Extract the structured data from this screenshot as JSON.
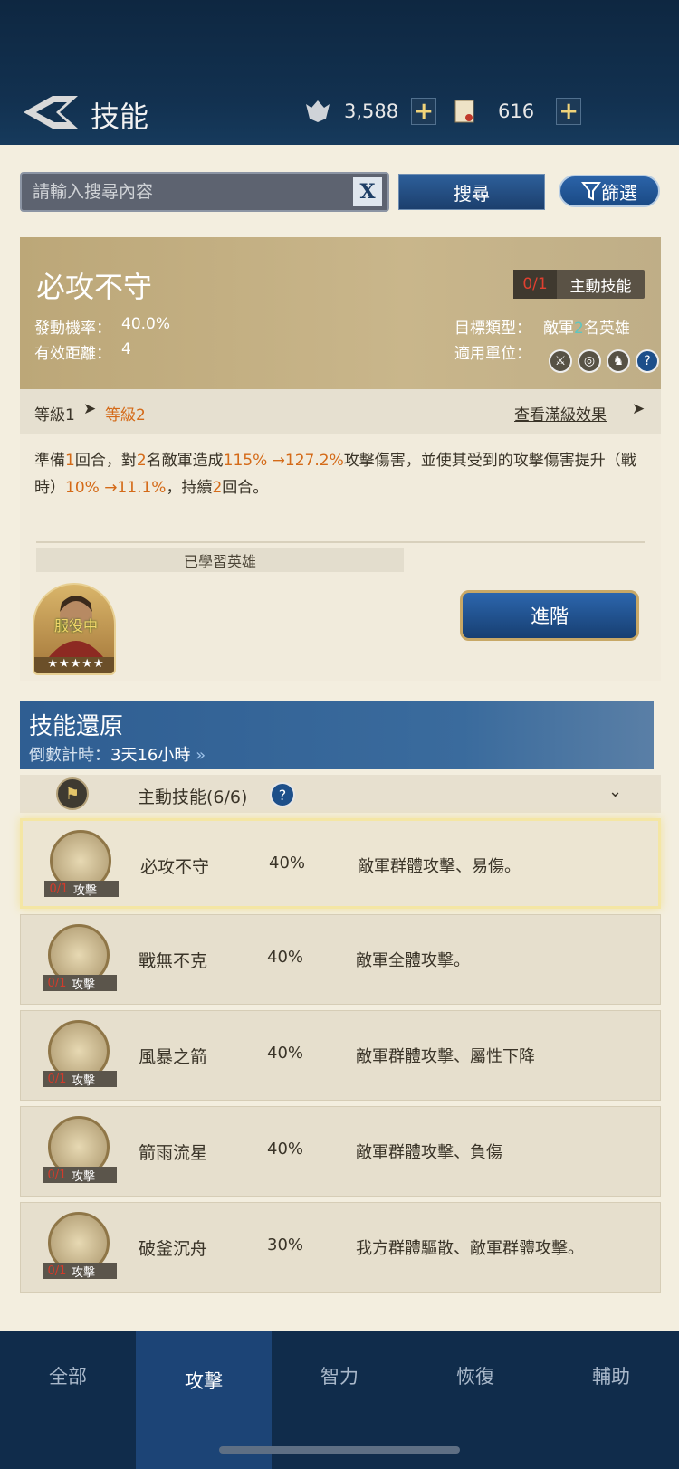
{
  "header": {
    "title": "技能",
    "res1_value": "3,588",
    "res2_value": "616",
    "plus": "+"
  },
  "search": {
    "placeholder": "請輸入搜尋內容",
    "clear_label": "X",
    "search_label": "搜尋",
    "filter_label": "篩選"
  },
  "skill": {
    "name": "必攻不守",
    "uses": "0/1",
    "type_label": "主動技能",
    "rate_label": "發動機率：",
    "rate_value": "40.0%",
    "range_label": "有效距離：",
    "range_value": "4",
    "target_label": "目標類型：",
    "target_value_a": "敵軍",
    "target_value_b": "2",
    "target_value_c": "名英雄",
    "units_label": "適用單位：",
    "level_from": "等級1",
    "level_to": "等級2",
    "max_effect_label": "查看滿級效果",
    "desc": {
      "a": "準備",
      "b": "1",
      "c": "回合，對",
      "d": "2",
      "e": "名敵軍造成",
      "f": "115% →127.2%",
      "g": "攻擊傷害，並使其受到的攻擊傷害提升（戰時）",
      "h": "10% →11.1%",
      "i": "，持續",
      "j": "2",
      "k": "回合。"
    },
    "learned_label": "已學習英雄",
    "hero_status": "服役中",
    "hero_stars": "★★★★★",
    "upgrade_label": "進階"
  },
  "reset": {
    "title": "技能還原",
    "countdown_label": "倒數計時：",
    "countdown_value": "3天16小時"
  },
  "category": {
    "label": "主動技能(6/6)"
  },
  "skills": [
    {
      "name": "必攻不守",
      "pct": "40%",
      "desc": "敵軍群體攻擊、易傷。",
      "badge": "攻擊",
      "count": "0/1"
    },
    {
      "name": "戰無不克",
      "pct": "40%",
      "desc": "敵軍全體攻擊。",
      "badge": "攻擊",
      "count": "0/1"
    },
    {
      "name": "風暴之箭",
      "pct": "40%",
      "desc": "敵軍群體攻擊、屬性下降",
      "badge": "攻擊",
      "count": "0/1"
    },
    {
      "name": "箭雨流星",
      "pct": "40%",
      "desc": "敵軍群體攻擊、負傷",
      "badge": "攻擊",
      "count": "0/1"
    },
    {
      "name": "破釜沉舟",
      "pct": "30%",
      "desc": "我方群體驅散、敵軍群體攻擊。",
      "badge": "攻擊",
      "count": "0/1"
    }
  ],
  "tabs": [
    "全部",
    "攻擊",
    "智力",
    "恢復",
    "輔助"
  ],
  "colors": {
    "accent": "#d46a18",
    "nav": "#102c4b",
    "gold": "#c9b68b"
  }
}
